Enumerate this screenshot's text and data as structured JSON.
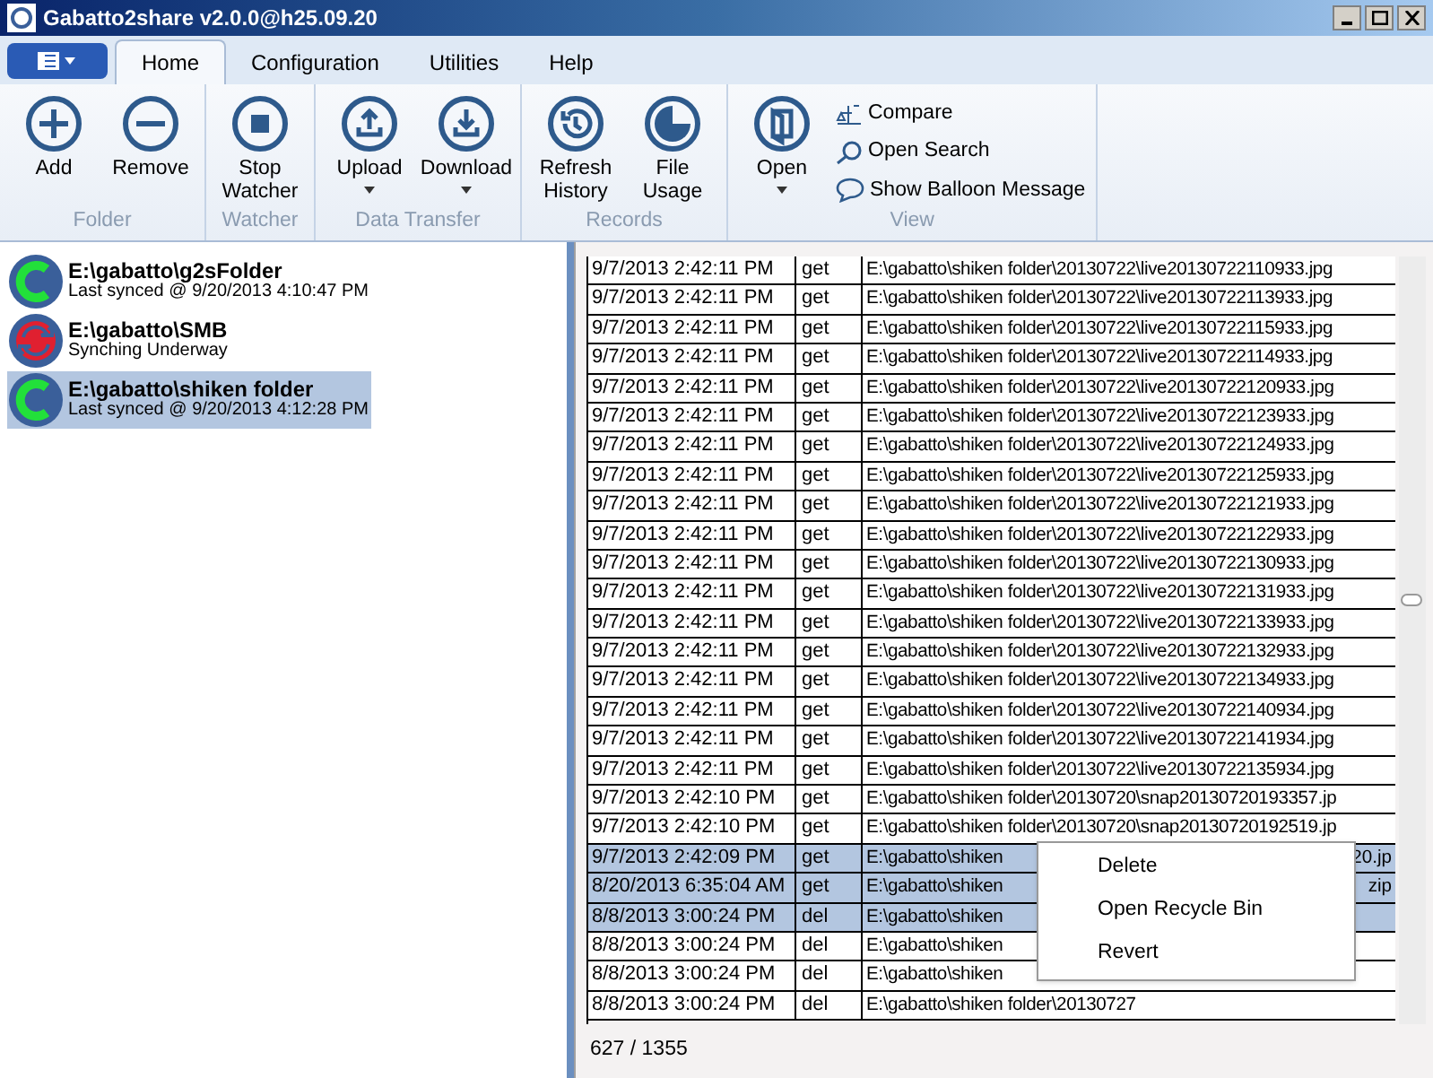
{
  "window": {
    "title": "Gabatto2share v2.0.0@h25.09.20"
  },
  "tabs": [
    {
      "label": "Home",
      "selected": true
    },
    {
      "label": "Configuration",
      "selected": false
    },
    {
      "label": "Utilities",
      "selected": false
    },
    {
      "label": "Help",
      "selected": false
    }
  ],
  "ribbon": {
    "groups": [
      {
        "label": "Folder",
        "buttons": [
          {
            "label": "Add",
            "dropdown": false
          },
          {
            "label": "Remove",
            "dropdown": false
          }
        ]
      },
      {
        "label": "Watcher",
        "buttons": [
          {
            "label": "Stop Watcher",
            "dropdown": false
          }
        ]
      },
      {
        "label": "Data Transfer",
        "buttons": [
          {
            "label": "Upload",
            "dropdown": true
          },
          {
            "label": "Download",
            "dropdown": true
          }
        ]
      },
      {
        "label": "Records",
        "buttons": [
          {
            "label": "Refresh History",
            "dropdown": false
          },
          {
            "label": "File Usage",
            "dropdown": false
          }
        ]
      },
      {
        "label": "View",
        "buttons": [
          {
            "label": "Open",
            "dropdown": true
          }
        ],
        "small_buttons": [
          "Compare",
          "Open Search",
          "Show Balloon Message"
        ]
      }
    ]
  },
  "folders": [
    {
      "path": "E:\\gabatto\\g2sFolder",
      "status": "Last synced @ 9/20/2013 4:10:47 PM",
      "kind": "synced",
      "selected": false
    },
    {
      "path": "E:\\gabatto\\SMB",
      "status": "Synching Underway",
      "kind": "syncing",
      "selected": false
    },
    {
      "path": "E:\\gabatto\\shiken folder",
      "status": "Last synced @ 9/20/2013 4:12:28 PM",
      "kind": "synced",
      "selected": true
    }
  ],
  "history": {
    "rows": [
      {
        "time": "9/7/2013 2:42:11 PM",
        "action": "get",
        "path": "E:\\gabatto\\shiken folder\\20130722\\live20130722110933.jpg",
        "selected": false
      },
      {
        "time": "9/7/2013 2:42:11 PM",
        "action": "get",
        "path": "E:\\gabatto\\shiken folder\\20130722\\live20130722113933.jpg",
        "selected": false
      },
      {
        "time": "9/7/2013 2:42:11 PM",
        "action": "get",
        "path": "E:\\gabatto\\shiken folder\\20130722\\live20130722115933.jpg",
        "selected": false
      },
      {
        "time": "9/7/2013 2:42:11 PM",
        "action": "get",
        "path": "E:\\gabatto\\shiken folder\\20130722\\live20130722114933.jpg",
        "selected": false
      },
      {
        "time": "9/7/2013 2:42:11 PM",
        "action": "get",
        "path": "E:\\gabatto\\shiken folder\\20130722\\live20130722120933.jpg",
        "selected": false
      },
      {
        "time": "9/7/2013 2:42:11 PM",
        "action": "get",
        "path": "E:\\gabatto\\shiken folder\\20130722\\live20130722123933.jpg",
        "selected": false
      },
      {
        "time": "9/7/2013 2:42:11 PM",
        "action": "get",
        "path": "E:\\gabatto\\shiken folder\\20130722\\live20130722124933.jpg",
        "selected": false
      },
      {
        "time": "9/7/2013 2:42:11 PM",
        "action": "get",
        "path": "E:\\gabatto\\shiken folder\\20130722\\live20130722125933.jpg",
        "selected": false
      },
      {
        "time": "9/7/2013 2:42:11 PM",
        "action": "get",
        "path": "E:\\gabatto\\shiken folder\\20130722\\live20130722121933.jpg",
        "selected": false
      },
      {
        "time": "9/7/2013 2:42:11 PM",
        "action": "get",
        "path": "E:\\gabatto\\shiken folder\\20130722\\live20130722122933.jpg",
        "selected": false
      },
      {
        "time": "9/7/2013 2:42:11 PM",
        "action": "get",
        "path": "E:\\gabatto\\shiken folder\\20130722\\live20130722130933.jpg",
        "selected": false
      },
      {
        "time": "9/7/2013 2:42:11 PM",
        "action": "get",
        "path": "E:\\gabatto\\shiken folder\\20130722\\live20130722131933.jpg",
        "selected": false
      },
      {
        "time": "9/7/2013 2:42:11 PM",
        "action": "get",
        "path": "E:\\gabatto\\shiken folder\\20130722\\live20130722133933.jpg",
        "selected": false
      },
      {
        "time": "9/7/2013 2:42:11 PM",
        "action": "get",
        "path": "E:\\gabatto\\shiken folder\\20130722\\live20130722132933.jpg",
        "selected": false
      },
      {
        "time": "9/7/2013 2:42:11 PM",
        "action": "get",
        "path": "E:\\gabatto\\shiken folder\\20130722\\live20130722134933.jpg",
        "selected": false
      },
      {
        "time": "9/7/2013 2:42:11 PM",
        "action": "get",
        "path": "E:\\gabatto\\shiken folder\\20130722\\live20130722140934.jpg",
        "selected": false
      },
      {
        "time": "9/7/2013 2:42:11 PM",
        "action": "get",
        "path": "E:\\gabatto\\shiken folder\\20130722\\live20130722141934.jpg",
        "selected": false
      },
      {
        "time": "9/7/2013 2:42:11 PM",
        "action": "get",
        "path": "E:\\gabatto\\shiken folder\\20130722\\live20130722135934.jpg",
        "selected": false
      },
      {
        "time": "9/7/2013 2:42:10 PM",
        "action": "get",
        "path": "E:\\gabatto\\shiken folder\\20130720\\snap20130720193357.jp",
        "selected": false
      },
      {
        "time": "9/7/2013 2:42:10 PM",
        "action": "get",
        "path": "E:\\gabatto\\shiken folder\\20130720\\snap20130720192519.jp",
        "selected": false
      },
      {
        "time": "9/7/2013 2:42:09 PM",
        "action": "get",
        "path": "E:\\gabatto\\shiken",
        "path_tail": "20.jp",
        "selected": true
      },
      {
        "time": "8/20/2013 6:35:04 AM",
        "action": "get",
        "path": "E:\\gabatto\\shiken",
        "path_tail": "zip",
        "selected": true
      },
      {
        "time": "8/8/2013 3:00:24 PM",
        "action": "del",
        "path": "E:\\gabatto\\shiken",
        "selected": true
      },
      {
        "time": "8/8/2013 3:00:24 PM",
        "action": "del",
        "path": "E:\\gabatto\\shiken",
        "selected": false
      },
      {
        "time": "8/8/2013 3:00:24 PM",
        "action": "del",
        "path": "E:\\gabatto\\shiken",
        "selected": false
      },
      {
        "time": "8/8/2013 3:00:24 PM",
        "action": "del",
        "path": "E:\\gabatto\\shiken folder\\20130727",
        "selected": false
      }
    ],
    "count": "627 / 1355"
  },
  "context_menu": [
    "Delete",
    "Open Recycle Bin",
    "Revert"
  ]
}
